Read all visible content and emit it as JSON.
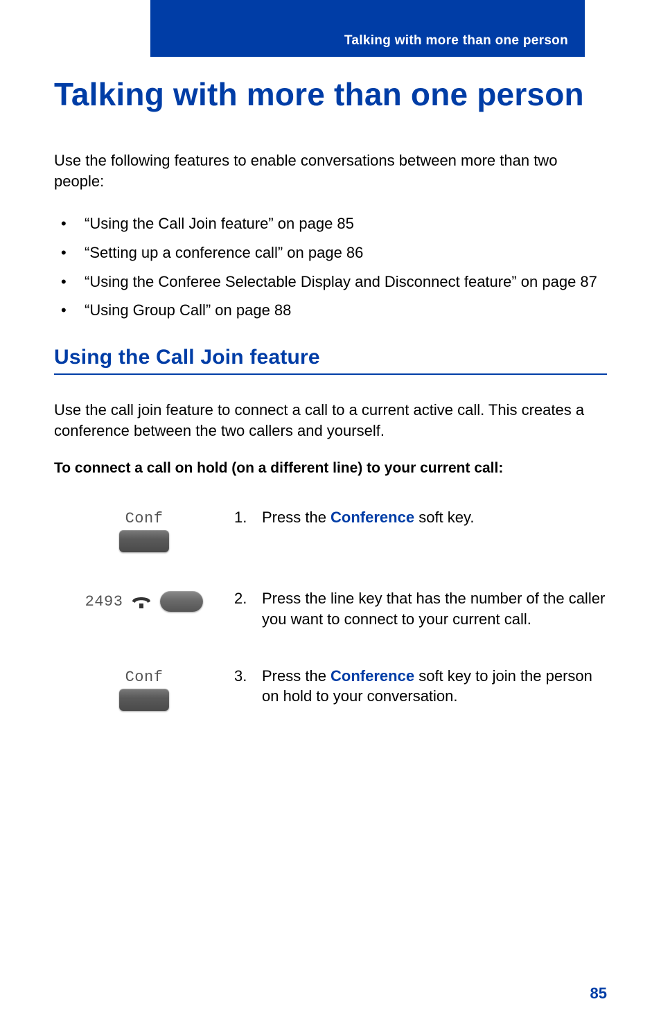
{
  "header": {
    "breadcrumb": "Talking with more than one person"
  },
  "title": "Talking with more than one person",
  "intro": "Use the following features to enable conversations between more than two people:",
  "bullets": [
    "“Using the Call Join feature” on page 85",
    "“Setting up a conference call” on page 86",
    "“Using the Conferee Selectable Display and Disconnect feature” on page 87",
    "“Using Group Call” on page 88"
  ],
  "section": {
    "heading": "Using the Call Join feature",
    "para": "Use the call join feature to connect a call to a current active call. This creates a conference between the two callers and yourself.",
    "procedure_title": "To connect a call on hold (on a different line) to your current call:"
  },
  "steps": [
    {
      "n": "1.",
      "pre": "Press the ",
      "kw": "Conference",
      "post": " soft key.",
      "img_label": "Conf"
    },
    {
      "n": "2.",
      "pre": "Press the line key that has the number of the caller you want to connect to your current call.",
      "kw": "",
      "post": "",
      "img_label": "2493"
    },
    {
      "n": "3.",
      "pre": "Press the ",
      "kw": "Conference",
      "post": " soft key to join the person on hold to your conversation.",
      "img_label": "Conf"
    }
  ],
  "page_number": "85"
}
